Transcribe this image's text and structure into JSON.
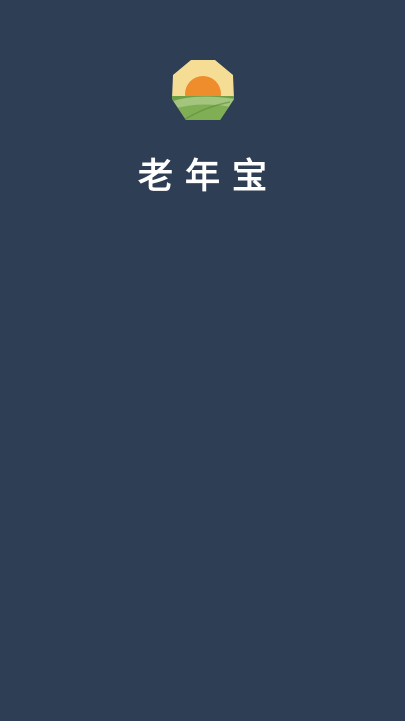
{
  "app": {
    "name": "老年宝",
    "logo_icon": "sunrise-over-fields-icon"
  },
  "colors": {
    "background": "#2d3e55",
    "logo_sky": "#f6dd96",
    "logo_sun": "#ef8c2c",
    "logo_field_dark": "#6e9f45",
    "logo_field_light": "#a3c57d",
    "text": "#ffffff"
  }
}
